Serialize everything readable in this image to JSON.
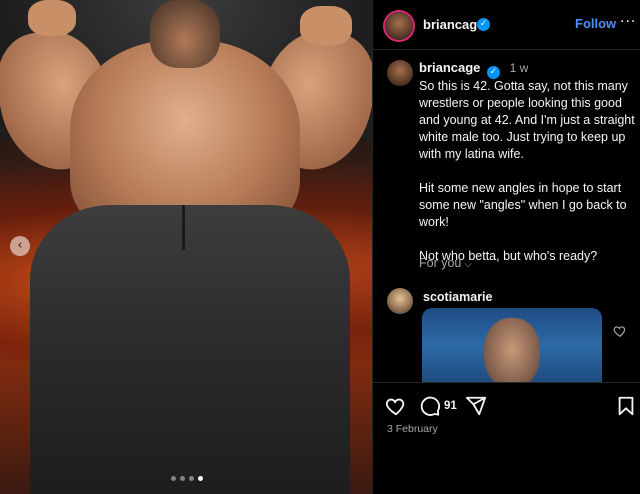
{
  "post": {
    "slide_indicator": {
      "count": 4,
      "active_index": 3
    },
    "prev_glyph": "‹"
  },
  "header": {
    "username": "briancage",
    "verified_glyph": "✓",
    "follow_label": "Follow",
    "more_glyph": "···"
  },
  "caption": {
    "username": "briancage",
    "verified_glyph": "✓",
    "time_ago": "1 w",
    "text": "So this is 42. Gotta say, not this many wrestlers or people looking this good and young at 42. And I'm just a straight white male too. Just trying to keep up with my latina wife.\n\nHit some new angles in hope to start some new \"angles\" when I go back to work!\n\nNot who betta, but who's ready?",
    "for_you_label": "For you",
    "chevron_glyph": "⌵"
  },
  "comment": {
    "username": "scotiamarie"
  },
  "actions": {
    "comment_count": "91",
    "date": "3 February"
  },
  "colors": {
    "follow": "#4f8ff7",
    "verified": "#0095f6",
    "background": "#000000",
    "muted_text": "#a8a8a8"
  }
}
